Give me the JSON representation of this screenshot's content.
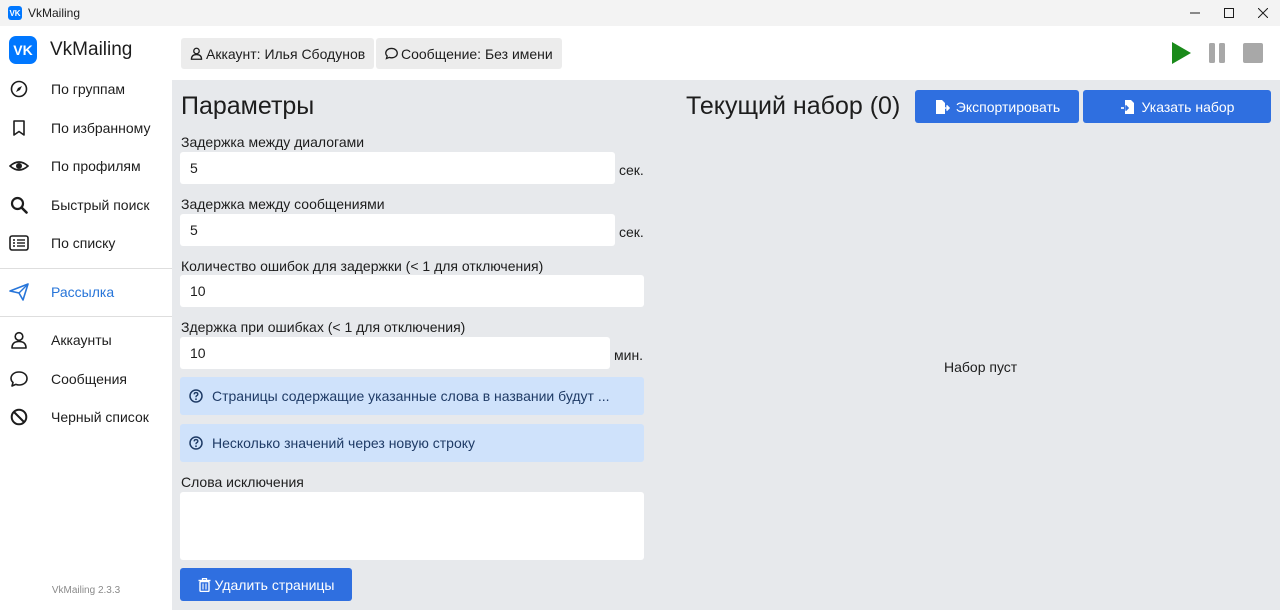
{
  "window": {
    "title": "VkMailing",
    "app_icon_text": "VK"
  },
  "sidebar": {
    "brand": "VkMailing",
    "logo_text": "VK",
    "items": [
      {
        "label": "По группам",
        "icon": "compass-icon"
      },
      {
        "label": "По избранному",
        "icon": "bookmark-icon"
      },
      {
        "label": "По профилям",
        "icon": "eye-icon"
      },
      {
        "label": "Быстрый поиск",
        "icon": "search-icon"
      },
      {
        "label": "По списку",
        "icon": "list-icon"
      },
      {
        "label": "Рассылка",
        "icon": "send-icon",
        "active": true
      },
      {
        "label": "Аккаунты",
        "icon": "user-icon"
      },
      {
        "label": "Сообщения",
        "icon": "chat-icon"
      },
      {
        "label": "Черный список",
        "icon": "ban-icon"
      }
    ],
    "version": "VkMailing 2.3.3"
  },
  "header": {
    "account_chip": "Аккаунт: Илья Сбодунов",
    "message_chip": "Сообщение: Без имени"
  },
  "params": {
    "title": "Параметры",
    "dialog_delay_label": "Задержка между диалогами",
    "dialog_delay_value": "5",
    "dialog_delay_unit": "сек.",
    "message_delay_label": "Задержка между сообщениями",
    "message_delay_value": "5",
    "message_delay_unit": "сек.",
    "error_count_label": "Количество ошибок для задержки (< 1 для отключения)",
    "error_count_value": "10",
    "error_delay_label": "Здержка при ошибках (< 1 для отключения)",
    "error_delay_value": "10",
    "error_delay_unit": "мин.",
    "info1": "Страницы содержащие указанные слова в названии будут ...",
    "info2": "Несколько значений через новую строку",
    "exclusion_label": "Слова исключения",
    "delete_button": "Удалить страницы"
  },
  "current_set": {
    "title": "Текущий набор (0)",
    "export_button": "Экспортировать",
    "specify_button": "Указать набор",
    "empty_text": "Набор пуст"
  },
  "colors": {
    "accent": "#2f6fe0",
    "play": "#1a8a1a",
    "info_bg": "#cfe2fb"
  }
}
